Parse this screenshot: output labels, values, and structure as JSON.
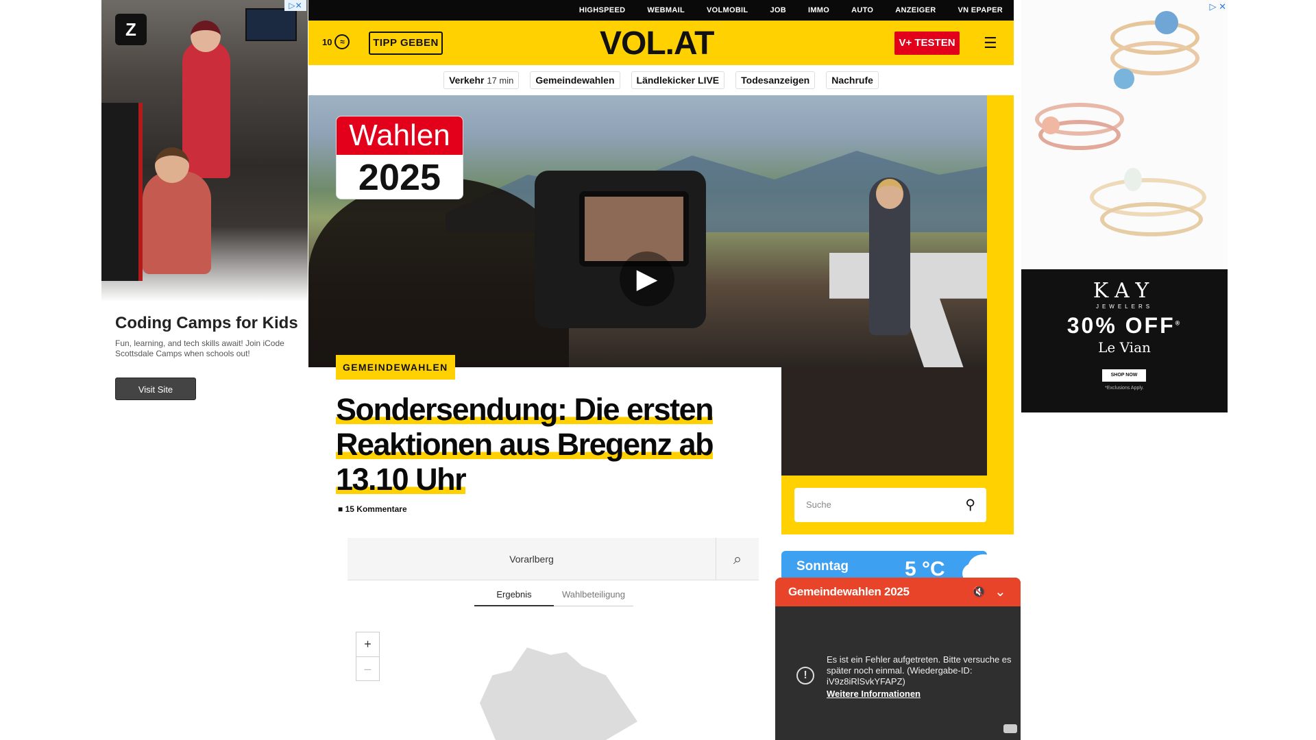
{
  "left_ad": {
    "adchoices": "▷✕",
    "title": "Coding Camps for Kids",
    "description": "Fun, learning, and tech skills await! Join iCode Scottsdale Camps when schools out!",
    "cta": "Visit Site"
  },
  "right_ad": {
    "adchoices": "▷ ✕",
    "brand": "KAY",
    "brand_sub": "JEWELERS",
    "offer": "30% OFF",
    "offer_mark": "®",
    "collection": "Le Vian",
    "cta": "SHOP NOW",
    "disclaimer": "*Exclusions Apply."
  },
  "topbar": {
    "links": [
      "HIGHSPEED",
      "WEBMAIL",
      "VOLMOBIL",
      "JOB",
      "IMMO",
      "AUTO",
      "ANZEIGER",
      "VN EPAPER"
    ]
  },
  "header": {
    "temperature": "10",
    "tipp_button": "TIPP GEBEN",
    "logo": "VOL.AT",
    "subscribe_button": "V+ TESTEN"
  },
  "nav": {
    "traffic_label": "Verkehr",
    "traffic_value": "17 min",
    "items": [
      "Gemeindewahlen",
      "Ländlekicker LIVE",
      "Todesanzeigen",
      "Nachrufe"
    ]
  },
  "hero": {
    "badge_top": "Wahlen",
    "badge_bottom": "2025"
  },
  "article": {
    "category": "GEMEINDEWAHLEN",
    "headline": "Sondersendung: Die ersten Reaktionen aus Bregenz ab 13.10 Uhr",
    "comments": "15 Kommentare"
  },
  "sidebar": {
    "search_placeholder": "Suche"
  },
  "election_widget": {
    "region": "Vorarlberg",
    "tabs": [
      "Ergebnis",
      "Wahlbeteiligung"
    ],
    "zoom_in": "+",
    "zoom_out": "–"
  },
  "weather": {
    "day": "Sonntag",
    "temperature": "5 °C"
  },
  "player": {
    "title": "Gemeindewahlen 2025",
    "error_message": "Es ist ein Fehler aufgetreten. Bitte versuche es später noch einmal. (Wiedergabe-ID: iV9z8iRlSvkYFAPZ)",
    "more_link": "Weitere Informationen"
  }
}
